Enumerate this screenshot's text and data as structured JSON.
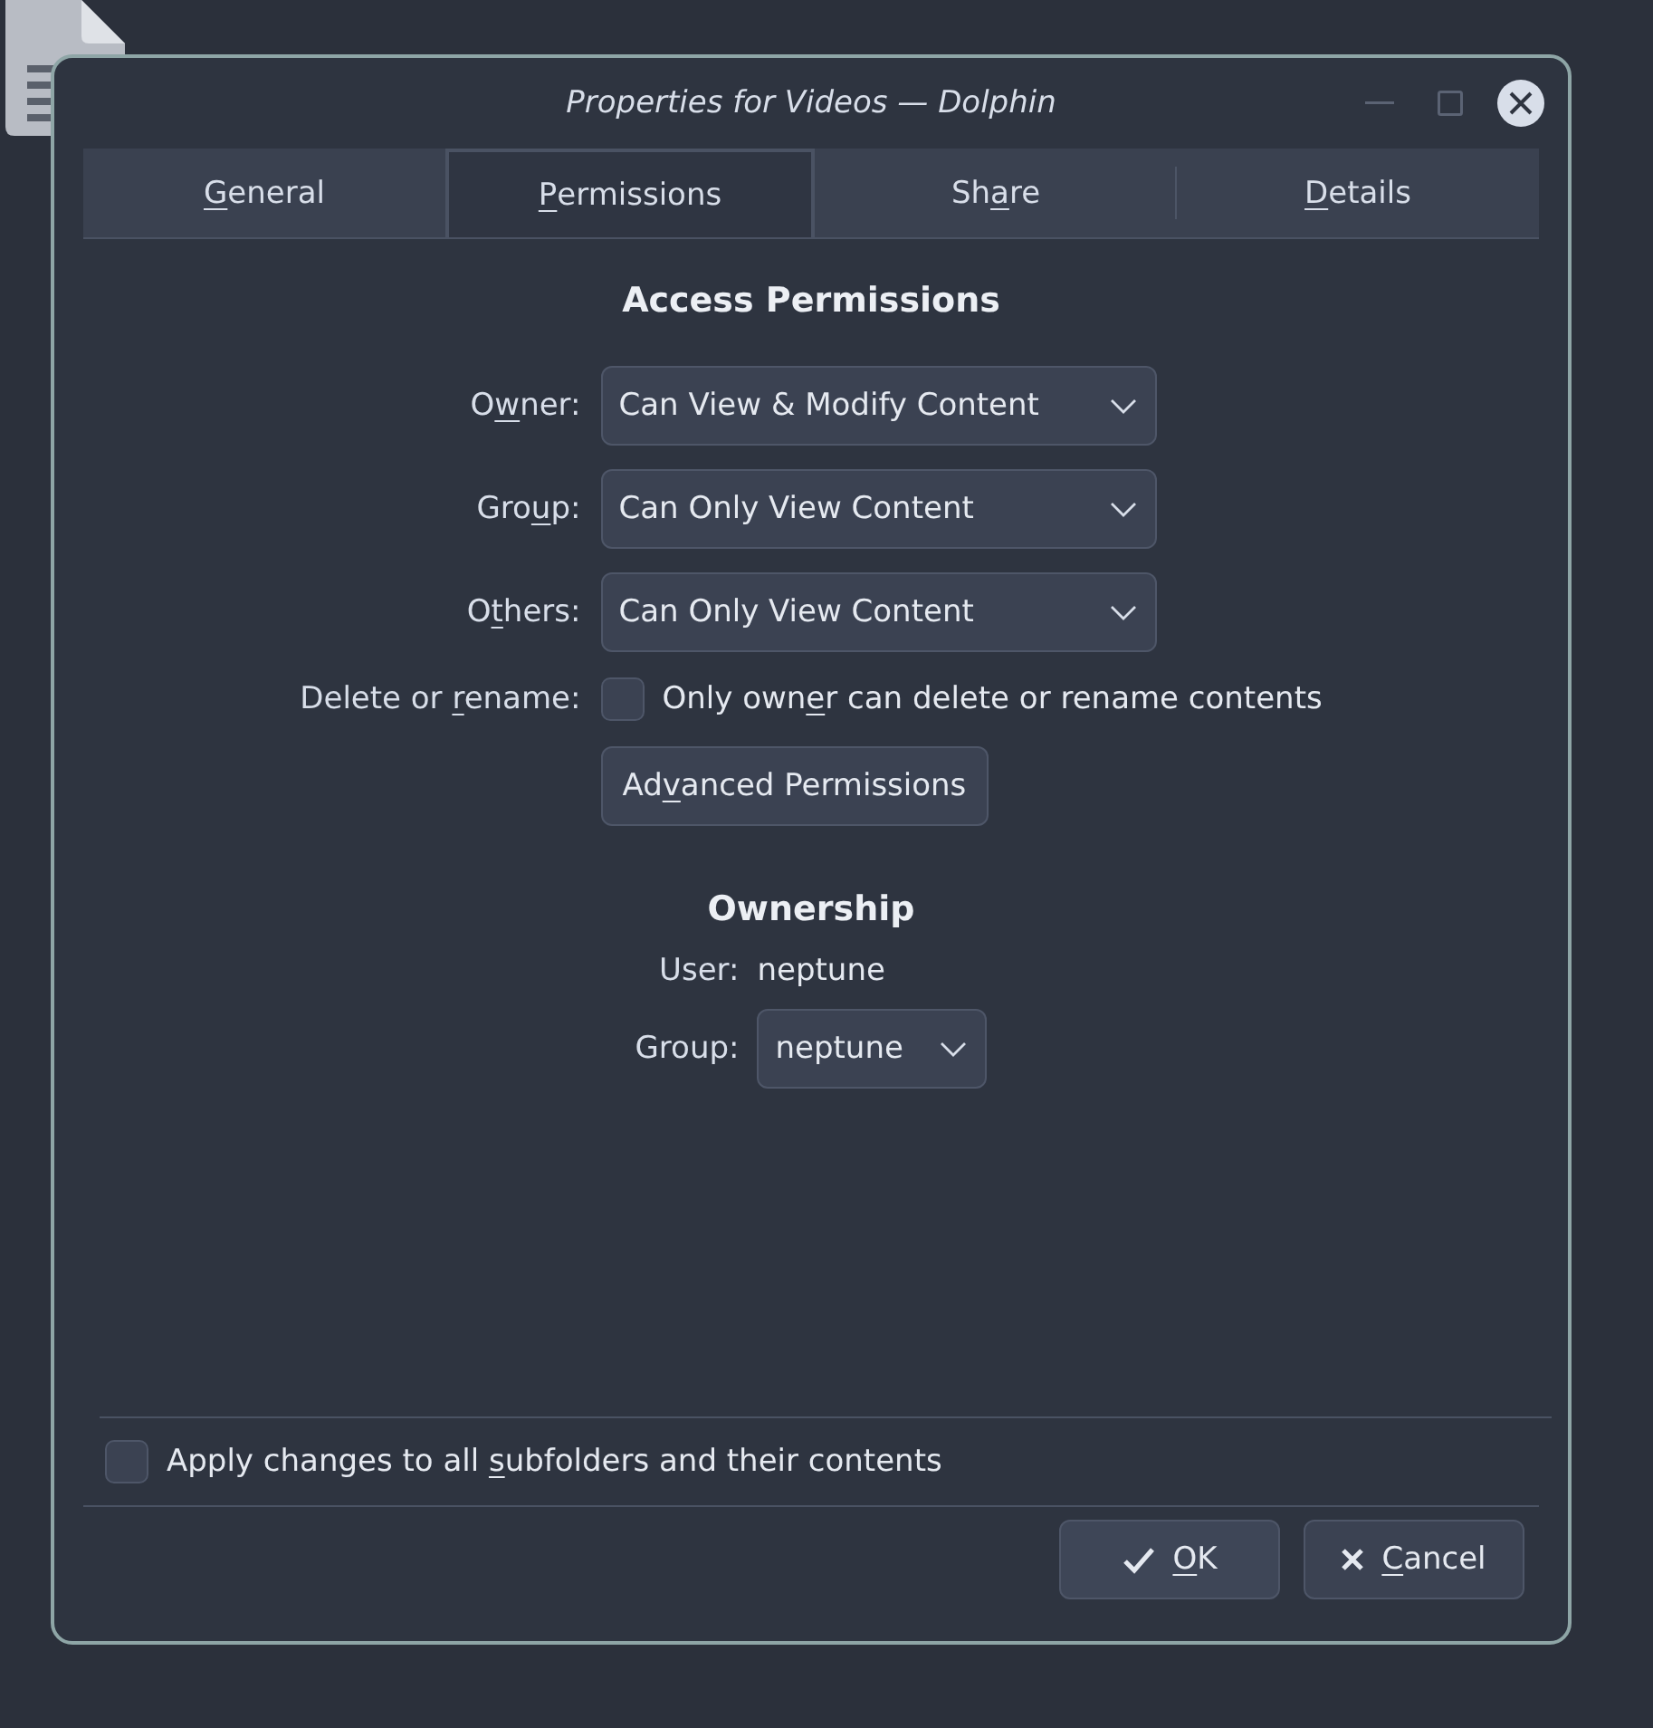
{
  "window": {
    "title": "Properties for Videos — Dolphin"
  },
  "tabs": [
    {
      "label": {
        "mnemonic": "G",
        "after": "eneral"
      },
      "selected": false
    },
    {
      "label": {
        "mnemonic": "P",
        "after": "ermissions"
      },
      "selected": true
    },
    {
      "label": {
        "before": "Sh",
        "mnemonic": "a",
        "after": "re"
      },
      "selected": false
    },
    {
      "label": {
        "mnemonic": "D",
        "after": "etails"
      },
      "selected": false
    }
  ],
  "access_permissions": {
    "heading": "Access Permissions",
    "rows": [
      {
        "kind": "dropdown",
        "label": {
          "before": "O",
          "mnemonic": "w",
          "after": "ner:"
        },
        "value": "Can View & Modify Content"
      },
      {
        "kind": "dropdown",
        "label": {
          "before": "Gro",
          "mnemonic": "u",
          "after": "p:"
        },
        "value": "Can Only View Content"
      },
      {
        "kind": "dropdown",
        "label": {
          "before": "O",
          "mnemonic": "t",
          "after": "hers:"
        },
        "value": "Can Only View Content"
      },
      {
        "kind": "checkbox",
        "label": {
          "before": "Delete or ",
          "mnemonic": "r",
          "after": "ename:"
        },
        "checked": false,
        "text": {
          "before": "Only own",
          "mnemonic": "e",
          "after": "r can delete or rename contents"
        }
      }
    ],
    "advanced_button": {
      "before": "Ad",
      "mnemonic": "v",
      "after": "anced Permissions"
    }
  },
  "ownership": {
    "heading": "Ownership",
    "user": {
      "label": "User:",
      "value": "neptune"
    },
    "group": {
      "label": "Group:",
      "value": "neptune"
    }
  },
  "apply_to_subfolders": {
    "checked": false,
    "label": {
      "before": "Apply changes to all ",
      "mnemonic": "s",
      "after": "ubfolders and their contents"
    }
  },
  "buttons": [
    {
      "kind": "ok",
      "label": {
        "mnemonic": "O",
        "after": "K"
      }
    },
    {
      "kind": "cancel",
      "label": {
        "mnemonic": "C",
        "after": "ancel"
      }
    }
  ]
}
